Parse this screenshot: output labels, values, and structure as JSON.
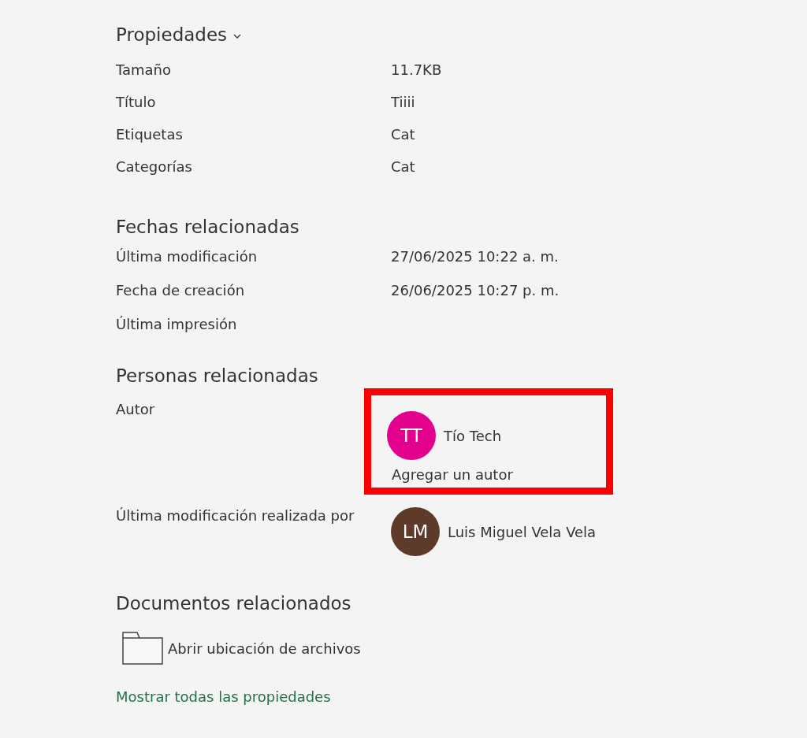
{
  "properties": {
    "title": "Propiedades",
    "expanded": true,
    "rows": [
      {
        "label": "Tamaño",
        "value": "11.7KB"
      },
      {
        "label": "Título",
        "value": "Tiiii"
      },
      {
        "label": "Etiquetas",
        "value": "Cat"
      },
      {
        "label": "Categorías",
        "value": "Cat"
      }
    ]
  },
  "related_dates": {
    "title": "Fechas relacionadas",
    "rows": [
      {
        "label": "Última modificación",
        "value": "27/06/2025 10:22 a. m."
      },
      {
        "label": "Fecha de creación",
        "value": "26/06/2025 10:27 p. m."
      },
      {
        "label": "Última impresión"
      }
    ]
  },
  "related_people": {
    "title": "Personas relacionadas",
    "rows": [
      {
        "label": "Autor",
        "highlighted": true,
        "people": [
          {
            "initials": "TT",
            "name": "Tío Tech",
            "color": "#e3008c"
          }
        ],
        "add_link": "Agregar un autor"
      },
      {
        "label": "Última modificación realizada por",
        "highlighted": false,
        "people": [
          {
            "initials": "LM",
            "name": "Luis Miguel Vela Vela",
            "color": "#5d3a2a"
          }
        ]
      }
    ]
  },
  "related_documents": {
    "title": "Documentos relacionados",
    "open_location": "Abrir ubicación de archivos"
  },
  "show_all_link": "Mostrar todas las propiedades"
}
